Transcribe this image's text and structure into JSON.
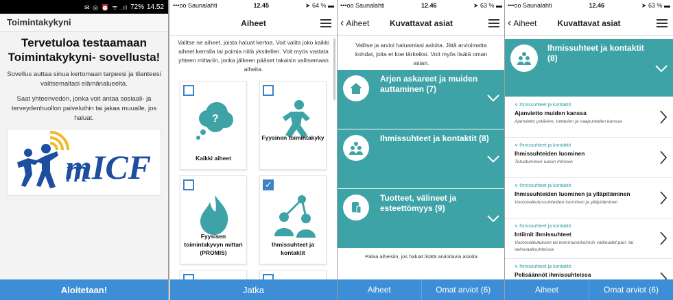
{
  "panel1": {
    "status": {
      "glyphs": "✉ ◎ ⏰ ᯤ .ıl",
      "battery": "72%",
      "time": "14.52"
    },
    "title": "Toimintakykyni",
    "heading": "Tervetuloa testaamaan Toimintakykyni- sovellusta!",
    "paragraph1": "Sovellus auttaa sinua kertomaan tarpeesi ja tilanteesi valitsemaltasi elämänalueelta.",
    "paragraph2": "Saat yhteenvedon, jonka voit antaa sosiaali- ja terveydenhuollon palveluihin tai jakaa muualle, jos haluat.",
    "logo_text": "mICF",
    "start_button": "Aloitetaan!"
  },
  "panel2": {
    "status": {
      "carrier": "•••oo Saunalahti",
      "time": "12.45",
      "battery": "64 %"
    },
    "nav_title": "Aiheet",
    "intro": "Valitse ne aiheet, joista haluat kertoa. Voit valita joko kaikki aiheet kerralla tai poimia niitä yksitellen. Voit myös vastata yhteen mittariin, jonka jälkeen pääset takaisin valitsemaan aiheita.",
    "cards": [
      {
        "label": "Kaikki aiheet",
        "checked": false
      },
      {
        "label": "Fyysinen toimintakyky",
        "checked": false
      },
      {
        "label": "Fyysisen toimintakyvyn mittari (PROMIS)",
        "checked": false
      },
      {
        "label": "Ihmissuhteet ja kontaktit",
        "checked": true
      }
    ],
    "continue_button": "Jatka"
  },
  "panel3": {
    "status": {
      "carrier": "•••oo Saunalahti",
      "time": "12.46",
      "battery": "63 %"
    },
    "back_label": "Aiheet",
    "nav_title": "Kuvattavat asiat",
    "intro": "Valitse ja arvioi haluamiasi asioita. Jätä arvioimatta kohdat, joita et koe tärkeiksi. Voit myös lisätä oman asian.",
    "categories": [
      {
        "title": "Arjen askareet ja muiden auttaminen (7)"
      },
      {
        "title": "Ihmissuhteet ja kontaktit (8)"
      },
      {
        "title": "Tuotteet, välineet ja esteettömyys (9)"
      }
    ],
    "footer": "Palaa aiheisiin, jos haluat lisätä arvioitavia asioita",
    "tab_topics": "Aiheet",
    "tab_ratings": "Omat arviot (6)"
  },
  "panel4": {
    "status": {
      "carrier": "•••oo Saunalahti",
      "time": "12.46",
      "battery": "63 %"
    },
    "back_label": "Aiheet",
    "nav_title": "Kuvattavat asiat",
    "header_title": "Ihmissuhteet ja kontaktit (8)",
    "items": [
      {
        "category": "∨ Ihmissuhteet ja kontaktit",
        "title": "Ajanvietto muiden kanssa",
        "desc": "Ajanvietto ystävien, tuttavien ja naapureiden kanssa"
      },
      {
        "category": "∨ Ihmissuhteet ja kontaktit",
        "title": "Ihmissuhteiden luominen",
        "desc": "Tutustuminen uusiin ihmisiin"
      },
      {
        "category": "∨ Ihmissuhteet ja kontaktit",
        "title": "Ihmissuhteiden luominen ja ylläpitäminen",
        "desc": "Vuorovaikutussuhteiden luominen ja ylläpitäminen"
      },
      {
        "category": "∨ Ihmissuhteet ja kontaktit",
        "title": "Intiimit ihmissuhteet",
        "desc": "Vuorovaikutuksen tai kommunnikoinnin vaikeudet pari- tai seksuaalisuhteissa"
      },
      {
        "category": "∨ Ihmissuhteet ja kontaktit",
        "title": "Pelisäännöt ihmissuhteissa",
        "desc": ""
      }
    ],
    "tab_topics": "Aiheet",
    "tab_ratings": "Omat arviot (6)"
  },
  "colors": {
    "teal": "#3ea3a7",
    "blue": "#3d8ed6",
    "checkbox_blue": "#3d82c4",
    "logo_blue": "#1d4ea0",
    "logo_yellow": "#f0b92a"
  }
}
